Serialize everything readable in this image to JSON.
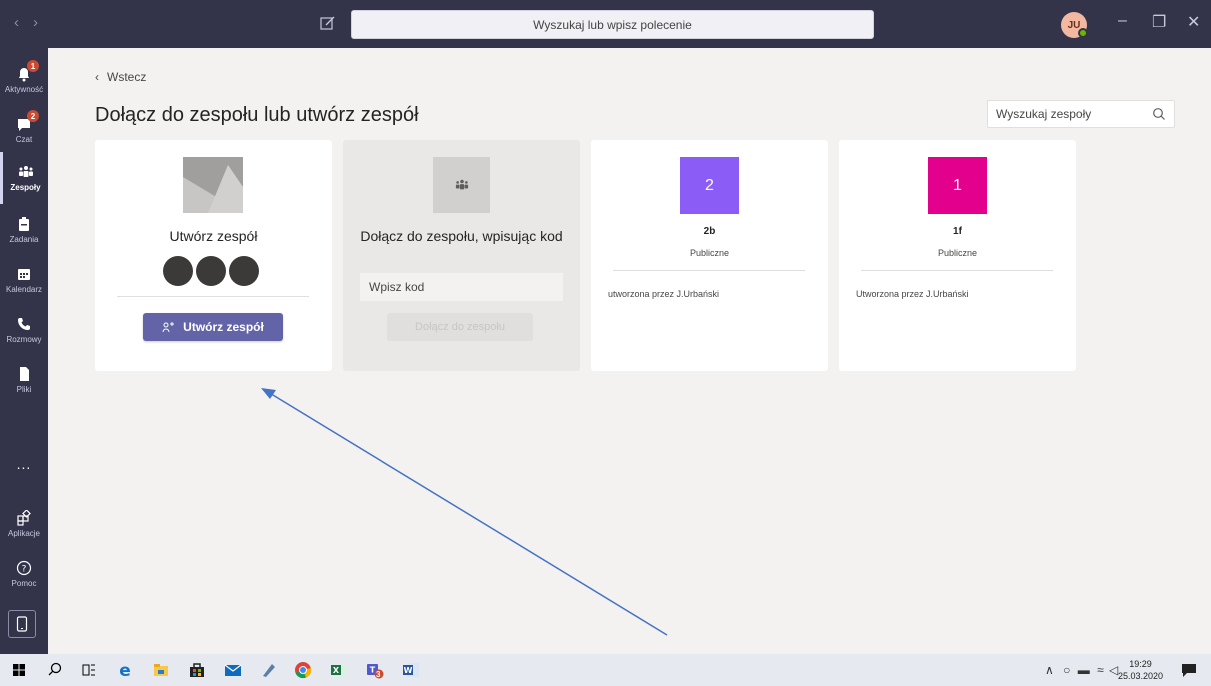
{
  "topbar": {
    "search_placeholder": "Wyszukaj lub wpisz polecenie",
    "avatar_initials": "JU",
    "colors": {
      "bar": "#33344a",
      "presence": "#6bb700"
    }
  },
  "rail": {
    "items": [
      {
        "label": "Aktywność",
        "icon": "bell-icon",
        "badge": "1"
      },
      {
        "label": "Czat",
        "icon": "chat-icon",
        "badge": "2"
      },
      {
        "label": "Zespoły",
        "icon": "teams-icon",
        "active": true
      },
      {
        "label": "Zadania",
        "icon": "assignments-icon"
      },
      {
        "label": "Kalendarz",
        "icon": "calendar-icon"
      },
      {
        "label": "Rozmowy",
        "icon": "phone-icon"
      },
      {
        "label": "Pliki",
        "icon": "files-icon"
      }
    ],
    "more": "...",
    "apps_label": "Aplikacje",
    "help_label": "Pomoc"
  },
  "main": {
    "back_label": "Wstecz",
    "title": "Dołącz do zespołu lub utwórz zespół",
    "search_teams_placeholder": "Wyszukaj zespoły"
  },
  "create_card": {
    "title": "Utwórz zespół",
    "button_label": "Utwórz zespół"
  },
  "join_card": {
    "title": "Dołącz do zespołu, wpisując kod",
    "code_placeholder": "Wpisz kod",
    "button_label": "Dołącz do zespołu"
  },
  "teams": [
    {
      "tile": "2",
      "name": "2b",
      "visibility": "Publiczne",
      "owner": "utworzona przez J.Urbański",
      "color": "#8b5cf6"
    },
    {
      "tile": "1",
      "name": "1f",
      "visibility": "Publiczne",
      "owner": "Utworzona przez J.Urbański",
      "color": "#e3008c"
    }
  ],
  "taskbar": {
    "time": "19:29",
    "date": "25.03.2020",
    "teams_badge": "3"
  }
}
